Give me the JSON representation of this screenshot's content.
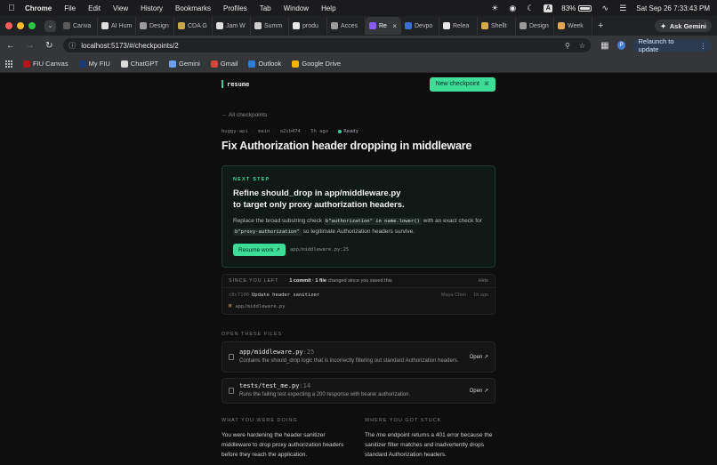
{
  "menubar": {
    "app": "Chrome",
    "items": [
      "File",
      "Edit",
      "View",
      "History",
      "Bookmarks",
      "Profiles",
      "Tab",
      "Window",
      "Help"
    ],
    "battery": "83%",
    "clock": "Sat Sep 26  7:33:43 PM"
  },
  "tabs": [
    {
      "label": "Canva",
      "color": "#5a5a5a"
    },
    {
      "label": "AI Hum",
      "color": "#e0e0e0"
    },
    {
      "label": "Design",
      "color": "#9b9b9b"
    },
    {
      "label": "CDA G",
      "color": "#c7a84a"
    },
    {
      "label": "Jam W",
      "color": "#e0e0e0"
    },
    {
      "label": "Summ",
      "color": "#cfcfcf"
    },
    {
      "label": "produ",
      "color": "#e8e8e8"
    },
    {
      "label": "Acces",
      "color": "#9b9b9b"
    },
    {
      "label": "Re",
      "color": "#8b5cf6",
      "active": true
    },
    {
      "label": "Devpo",
      "color": "#3b6fd6"
    },
    {
      "label": "Relea",
      "color": "#e8e8e8"
    },
    {
      "label": "Shellt",
      "color": "#d4a94a"
    },
    {
      "label": "Design",
      "color": "#9b9b9b"
    },
    {
      "label": "Week",
      "color": "#e0a84a"
    }
  ],
  "ask_gemini": "Ask Gemini",
  "toolbar": {
    "url": "localhost:5173/#/checkpoints/2",
    "relaunch": "Relaunch to update",
    "profile_initial": "P"
  },
  "bookmarks": [
    {
      "label": "FIU Canvas",
      "color": "#b5121b"
    },
    {
      "label": "My FIU",
      "color": "#1d3a78"
    },
    {
      "label": "ChatGPT",
      "color": "#d9d9d9"
    },
    {
      "label": "Gemini",
      "color": "#6aa1f5"
    },
    {
      "label": "Gmail",
      "color": "#d44638"
    },
    {
      "label": "Outlook",
      "color": "#2f7bd6"
    },
    {
      "label": "Google Drive",
      "color": "#f4b400"
    }
  ],
  "app": {
    "brand": "resume",
    "new_checkpoint": "New checkpoint",
    "new_checkpoint_kbd": "⌘",
    "back_link": "← All checkpoints",
    "meta": {
      "repo": "buggy-api",
      "branch": "main",
      "sha": "a2ib474",
      "ago": "5h ago",
      "status": "Ready"
    },
    "title": "Fix Authorization header dropping in middleware",
    "next_step": {
      "label": "NEXT STEP",
      "title_line1": "Refine should_drop in app/middleware.py",
      "title_line2": "to target only proxy authorization headers.",
      "desc_a": "Replace the broad substring check ",
      "code_a": "b\"authorization\" in name.lower()",
      "desc_b": " with an exact check for ",
      "code_b": "b\"proxy-authorization\"",
      "desc_c": " so legitimate Authorization headers survive.",
      "resume_button": "Resume work ↗",
      "path": "app/middleware.py:25"
    },
    "since": {
      "label": "SINCE YOU LEFT",
      "summary_bold": "1 commit · 1 file",
      "summary_rest": " changed since you saved this",
      "hide": "Hide",
      "commit_hash": "c8c7106",
      "commit_msg": "Update header sanitizer",
      "commit_author": "Maya Chen",
      "commit_ago": "1h ago",
      "file_marker": "M",
      "file_path": "app/middleware.py"
    },
    "open_files": {
      "label": "OPEN THESE FILES",
      "items": [
        {
          "file": "app/middleware.py",
          "line": ":25",
          "desc": "Contains the should_drop logic that is incorrectly filtering out standard Authorization headers.",
          "open": "Open ↗"
        },
        {
          "file": "tests/test_me.py",
          "line": ":14",
          "desc": "Runs the failing test expecting a 200 response with bearer authorization.",
          "open": "Open ↗"
        }
      ]
    },
    "doing": {
      "label": "WHAT YOU WERE DOING",
      "text": "You were hardening the header sanitizer middleware to drop proxy authorization headers before they reach the application."
    },
    "stuck": {
      "label": "WHERE YOU GOT STUCK",
      "text": "The /me endpoint returns a 401 error because the sanitizer filter matches and inadvertently drops standard Authorization headers."
    }
  }
}
